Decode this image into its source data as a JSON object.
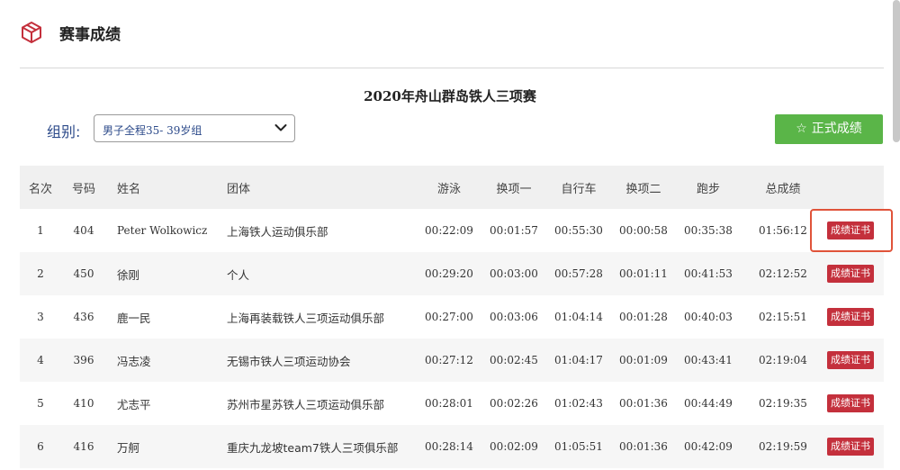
{
  "header": {
    "title": "赛事成绩",
    "icon": "cube-icon",
    "accent_color": "#c4303c"
  },
  "event": {
    "title": "2020年舟山群岛铁人三项赛"
  },
  "filter": {
    "label": "组别:",
    "selected": "男子全程35-  39岁组"
  },
  "official_button": {
    "icon": "star-outline-icon",
    "label": "正式成绩",
    "color": "#5ab548"
  },
  "table": {
    "columns": [
      "名次",
      "号码",
      "姓名",
      "团体",
      "游泳",
      "换项一",
      "自行车",
      "换项二",
      "跑步",
      "总成绩"
    ],
    "cert_label": "成绩证书",
    "rows": [
      {
        "rank": "1",
        "number": "404",
        "name": "Peter Wolkowicz",
        "team": "上海铁人运动俱乐部",
        "swim": "00:22:09",
        "t1": "00:01:57",
        "bike": "00:55:30",
        "t2": "00:00:58",
        "run": "00:35:38",
        "total": "01:56:12"
      },
      {
        "rank": "2",
        "number": "450",
        "name": "徐刚",
        "team": "个人",
        "swim": "00:29:20",
        "t1": "00:03:00",
        "bike": "00:57:28",
        "t2": "00:01:11",
        "run": "00:41:53",
        "total": "02:12:52"
      },
      {
        "rank": "3",
        "number": "436",
        "name": "鹿一民",
        "team": "上海再装载铁人三项运动俱乐部",
        "swim": "00:27:00",
        "t1": "00:03:06",
        "bike": "01:04:14",
        "t2": "00:01:28",
        "run": "00:40:03",
        "total": "02:15:51"
      },
      {
        "rank": "4",
        "number": "396",
        "name": "冯志凌",
        "team": "无锡市铁人三项运动协会",
        "swim": "00:27:12",
        "t1": "00:02:45",
        "bike": "01:04:17",
        "t2": "00:01:09",
        "run": "00:43:41",
        "total": "02:19:04"
      },
      {
        "rank": "5",
        "number": "410",
        "name": "尤志平",
        "team": "苏州市星苏铁人三项运动俱乐部",
        "swim": "00:28:01",
        "t1": "00:02:26",
        "bike": "01:02:43",
        "t2": "00:01:36",
        "run": "00:44:49",
        "total": "02:19:35"
      },
      {
        "rank": "6",
        "number": "416",
        "name": "万舸",
        "team": "重庆九龙坡team7铁人三项俱乐部",
        "swim": "00:28:14",
        "t1": "00:02:09",
        "bike": "01:05:51",
        "t2": "00:01:36",
        "run": "00:42:09",
        "total": "02:19:59"
      }
    ]
  }
}
